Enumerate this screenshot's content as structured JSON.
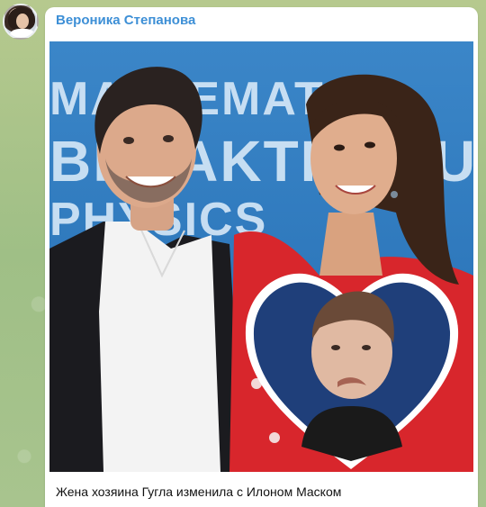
{
  "message": {
    "sender_name": "Вероника Степанова",
    "caption": "Жена хозяина Гугла изменила с Илоном Маском"
  },
  "photo": {
    "backdrop_words": [
      "MATHEMATICS",
      "BREAKTHROUGH",
      "PHYSICS"
    ]
  },
  "colors": {
    "sender_name": "#3d8fd6",
    "backdrop_blue": "#2f7fc0",
    "dress_red": "#d8262c",
    "wallpaper": "#a9c089"
  }
}
